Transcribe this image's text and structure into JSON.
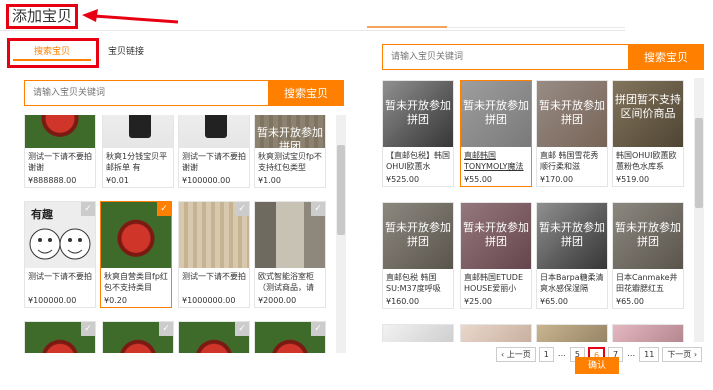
{
  "title": "添加宝贝",
  "tabs": {
    "search": "搜索宝贝",
    "link": "宝贝链接"
  },
  "search_left": {
    "placeholder": "请输入宝贝关键词",
    "button": "搜索宝贝"
  },
  "search_right": {
    "placeholder": "请输入宝贝关键词",
    "button": "搜索宝贝"
  },
  "left_items": [
    {
      "name": "测试一下请不要拍谢谢",
      "price": "¥888888.00"
    },
    {
      "name": "秋爽1分钱宝贝平邮拆单 有",
      "price": "¥0.01"
    },
    {
      "name": "测试一下请不要拍谢谢",
      "price": "¥100000.00"
    },
    {
      "name": "秋爽测试宝贝fp不支持红包类型",
      "price": "¥1.00"
    },
    {
      "name": "测试一下请不要拍",
      "price": "¥100000.00"
    },
    {
      "name": "秋爽自营类目fp红包不支持类目",
      "price": "¥0.20"
    },
    {
      "name": "测试一下请不要拍",
      "price": "¥1000000.00"
    },
    {
      "name": "欧式智能浴室柜（测试商品，请",
      "price": "¥2000.00"
    }
  ],
  "overlay_text": "暂未开放参加拼团",
  "overlay_text_alt": "拼团暂不支持区间价商品",
  "meme_text": "有趣",
  "right_items": [
    {
      "name": "【直邮包税】韩国OHUI欧蕙水",
      "price": "¥525.00"
    },
    {
      "name": "直邮韩国TONYMOLY魔法",
      "price": "¥55.00"
    },
    {
      "name": "直邮 韩国雪花秀顺行柔和滋",
      "price": "¥170.00"
    },
    {
      "name": "韩国OHUI欧蕙欧蕙粉色水库系",
      "price": "¥519.00"
    },
    {
      "name": "直邮包税 韩国SU:M37度呼吸",
      "price": "¥160.00"
    },
    {
      "name": "直邮韩国ETUDE HOUSE爱丽小",
      "price": "¥25.00"
    },
    {
      "name": "日本Barpa糖柔清爽水感保湿隔",
      "price": "¥65.00"
    },
    {
      "name": "日本Canmake井田花瓣腮红五",
      "price": "¥65.00"
    }
  ],
  "pager": {
    "prev": "上一页",
    "pages": [
      "1",
      "…",
      "5",
      "6",
      "7",
      "…",
      "11"
    ],
    "next": "下一页",
    "current": "6"
  },
  "confirm": "确认",
  "check_mark": "✓",
  "colors": {
    "accent": "#ff7f00",
    "annotation": "#e60012"
  }
}
